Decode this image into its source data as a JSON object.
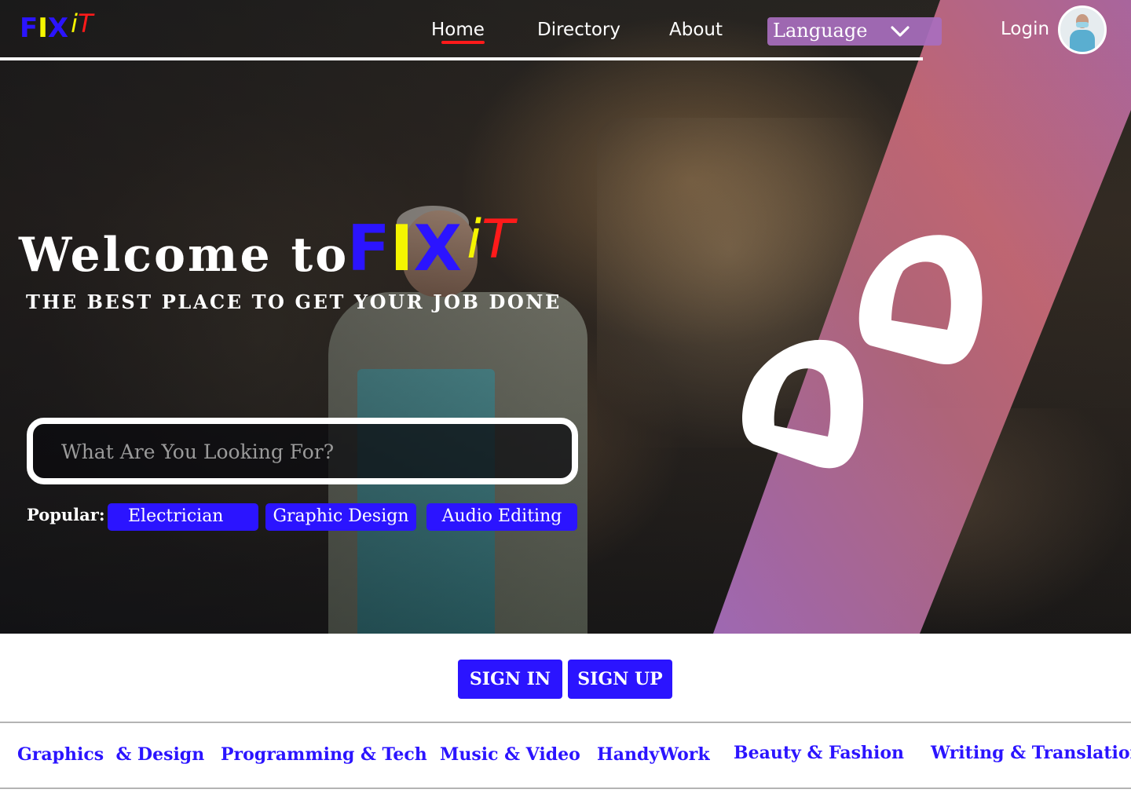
{
  "brand": {
    "logo_f": "F",
    "logo_i": "I",
    "logo_x": "X",
    "logo_small_i": "i",
    "logo_t": "T"
  },
  "nav": {
    "items": [
      {
        "label": "Home",
        "active": true
      },
      {
        "label": "Directory"
      },
      {
        "label": "About"
      }
    ],
    "language_label": "Language",
    "login_label": "Login"
  },
  "hero": {
    "welcome": "Welcome to",
    "tagline": "THE BEST PLACE TO GET YOUR JOB DONE",
    "search_placeholder": "What Are You Looking For?",
    "popular_label": "Popular:",
    "popular_tags": [
      "Electrician",
      "Graphic Design",
      "Audio Editing"
    ]
  },
  "auth": {
    "sign_in": "SIGN IN",
    "sign_up": "SIGN UP"
  },
  "categories": [
    "Graphics  & Design",
    "Programming & Tech",
    "Music & Video",
    "HandyWork",
    "Beauty & Fashion",
    "Writing & Translation"
  ],
  "colors": {
    "brand_blue": "#2b14ff",
    "brand_yellow": "#f5f500",
    "brand_red": "#ff1a1a",
    "ribbon_purple": "#a86ebe",
    "ribbon_pink": "#c96a78"
  },
  "icons": {
    "language_dropdown": "chevron-down-icon",
    "avatar": "user-avatar"
  }
}
